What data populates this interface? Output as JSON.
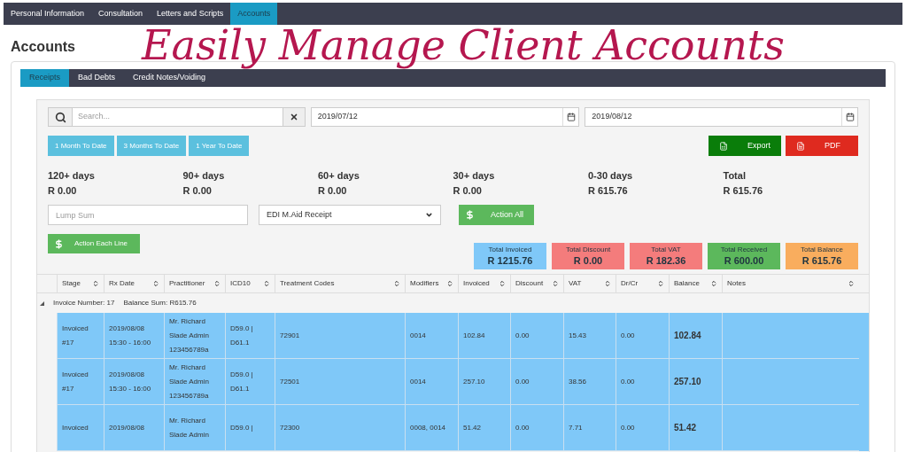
{
  "nav_tabs": [
    {
      "label": "Personal Information",
      "selected": false
    },
    {
      "label": "Consultation",
      "selected": false
    },
    {
      "label": "Letters and Scripts",
      "selected": false
    },
    {
      "label": "Accounts",
      "selected": true
    }
  ],
  "page_title": "Accounts",
  "headline": "Easily Manage Client Accounts",
  "sub_tabs": [
    {
      "label": "Receipts",
      "selected": true
    },
    {
      "label": "Bad Debts",
      "selected": false
    },
    {
      "label": "Credit Notes/Voiding",
      "selected": false
    }
  ],
  "search": {
    "placeholder": "Search..."
  },
  "date_from": "2019/07/12",
  "date_to": "2019/08/12",
  "range_buttons": [
    "1 Month To Date",
    "3 Months To Date",
    "1 Year To Date"
  ],
  "export_buttons": [
    {
      "kind": "export",
      "label": "Export"
    },
    {
      "kind": "pdf",
      "label": "PDF"
    }
  ],
  "aging": [
    {
      "label": "120+ days",
      "value": "R 0.00"
    },
    {
      "label": "90+ days",
      "value": "R 0.00"
    },
    {
      "label": "60+ days",
      "value": "R 0.00"
    },
    {
      "label": "30+ days",
      "value": "R 0.00"
    },
    {
      "label": "0-30 days",
      "value": "R 615.76"
    },
    {
      "label": "Total",
      "value": "R 615.76"
    }
  ],
  "lump_sum": {
    "placeholder": "Lump Sum"
  },
  "receipt_type": "EDI M.Aid Receipt",
  "action_all": "Action All",
  "action_each": "Action Each Line",
  "totals": [
    {
      "label": "Total Invoiced",
      "value": "R 1215.76",
      "color": "#7fc8f8"
    },
    {
      "label": "Total Discount",
      "value": "R 0.00",
      "color": "#f47c7c"
    },
    {
      "label": "Total VAT",
      "value": "R 182.36",
      "color": "#f47c7c"
    },
    {
      "label": "Total Received",
      "value": "R 600.00",
      "color": "#5cb85c"
    },
    {
      "label": "Total Balance",
      "value": "R 615.76",
      "color": "#f9ad5e"
    }
  ],
  "table": {
    "columns": [
      "Stage",
      "Rx Date",
      "Practitioner",
      "ICD10",
      "Treatment Codes",
      "Modifiers",
      "Invoiced",
      "Discount",
      "VAT",
      "Dr/Cr",
      "Balance",
      "Notes"
    ],
    "group": {
      "expanded": true,
      "invoice": "Invoice Number: 17",
      "balance": "Balance Sum: R615.76"
    },
    "rows": [
      {
        "selected": true,
        "cells": [
          [
            "Invoiced",
            "#17"
          ],
          [
            "2019/08/08",
            "15:30 - 16:00"
          ],
          [
            "Mr. Richard",
            "Slade Admin",
            "123456789a"
          ],
          [
            "D59.0 |",
            "D61.1"
          ],
          [
            "72901"
          ],
          [
            "0014"
          ],
          [
            "102.84"
          ],
          [
            "0.00"
          ],
          [
            "15.43"
          ],
          [
            "0.00"
          ],
          [
            "102.84"
          ],
          []
        ]
      },
      {
        "selected": true,
        "cells": [
          [
            "Invoiced",
            "#17"
          ],
          [
            "2019/08/08",
            "15:30 - 16:00"
          ],
          [
            "Mr. Richard",
            "Slade Admin",
            "123456789a"
          ],
          [
            "D59.0 |",
            "D61.1"
          ],
          [
            "72501"
          ],
          [
            "0014"
          ],
          [
            "257.10"
          ],
          [
            "0.00"
          ],
          [
            "38.56"
          ],
          [
            "0.00"
          ],
          [
            "257.10"
          ],
          []
        ]
      },
      {
        "selected": true,
        "cells": [
          [
            "Invoiced"
          ],
          [
            "2019/08/08"
          ],
          [
            "Mr. Richard",
            "Slade Admin"
          ],
          [
            "D59.0 |"
          ],
          [
            "72300"
          ],
          [
            "0008, 0014"
          ],
          [
            "51.42"
          ],
          [
            "0.00"
          ],
          [
            "7.71"
          ],
          [
            "0.00"
          ],
          [
            "51.42"
          ],
          []
        ]
      }
    ]
  }
}
